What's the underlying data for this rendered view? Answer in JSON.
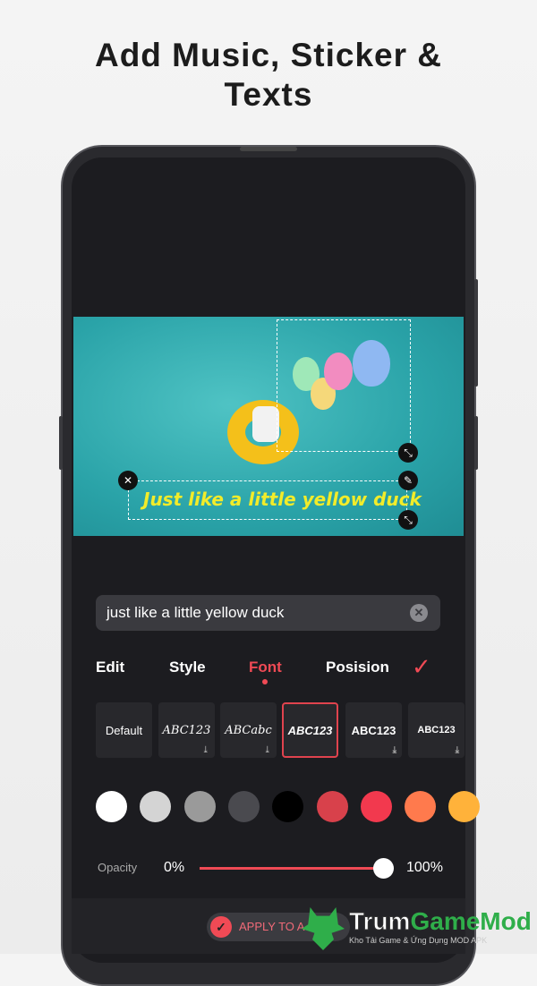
{
  "headline": {
    "line1": "Add Music, Sticker &",
    "line2": "Texts"
  },
  "video": {
    "caption": "Just like a little yellow duck",
    "handles": {
      "close": "close-icon",
      "edit": "edit-icon",
      "resize": "resize-icon"
    }
  },
  "text_input": {
    "value": "just like a little yellow duck",
    "clear_icon": "clear-icon"
  },
  "tabs": [
    {
      "label": "Edit"
    },
    {
      "label": "Style"
    },
    {
      "label": "Font",
      "active": true
    },
    {
      "label": "Posision"
    }
  ],
  "confirm_icon": "checkmark-icon",
  "fonts": [
    {
      "label": "Default"
    },
    {
      "label": "ABC123",
      "download": true
    },
    {
      "label": "ABCabc",
      "download": true
    },
    {
      "label": "ABC123",
      "selected": true
    },
    {
      "label": "ABC123",
      "download": true
    },
    {
      "label": "ABC123",
      "download": true
    }
  ],
  "colors": [
    "#ffffff",
    "#d4d4d4",
    "#9a9a9a",
    "#4a4a4f",
    "#000000",
    "#d8414b",
    "#f2394e",
    "#ff7a4d",
    "#ffb23a"
  ],
  "opacity": {
    "label": "Opacity",
    "min_label": "0%",
    "max_label": "100%",
    "value": 100
  },
  "accent": "#f04a55",
  "apply": {
    "label": "APPLY TO A"
  },
  "watermark": {
    "brand": "TrumGameMod",
    "tagline": "Kho Tải Game & Ứng Dụng MOD APK"
  }
}
